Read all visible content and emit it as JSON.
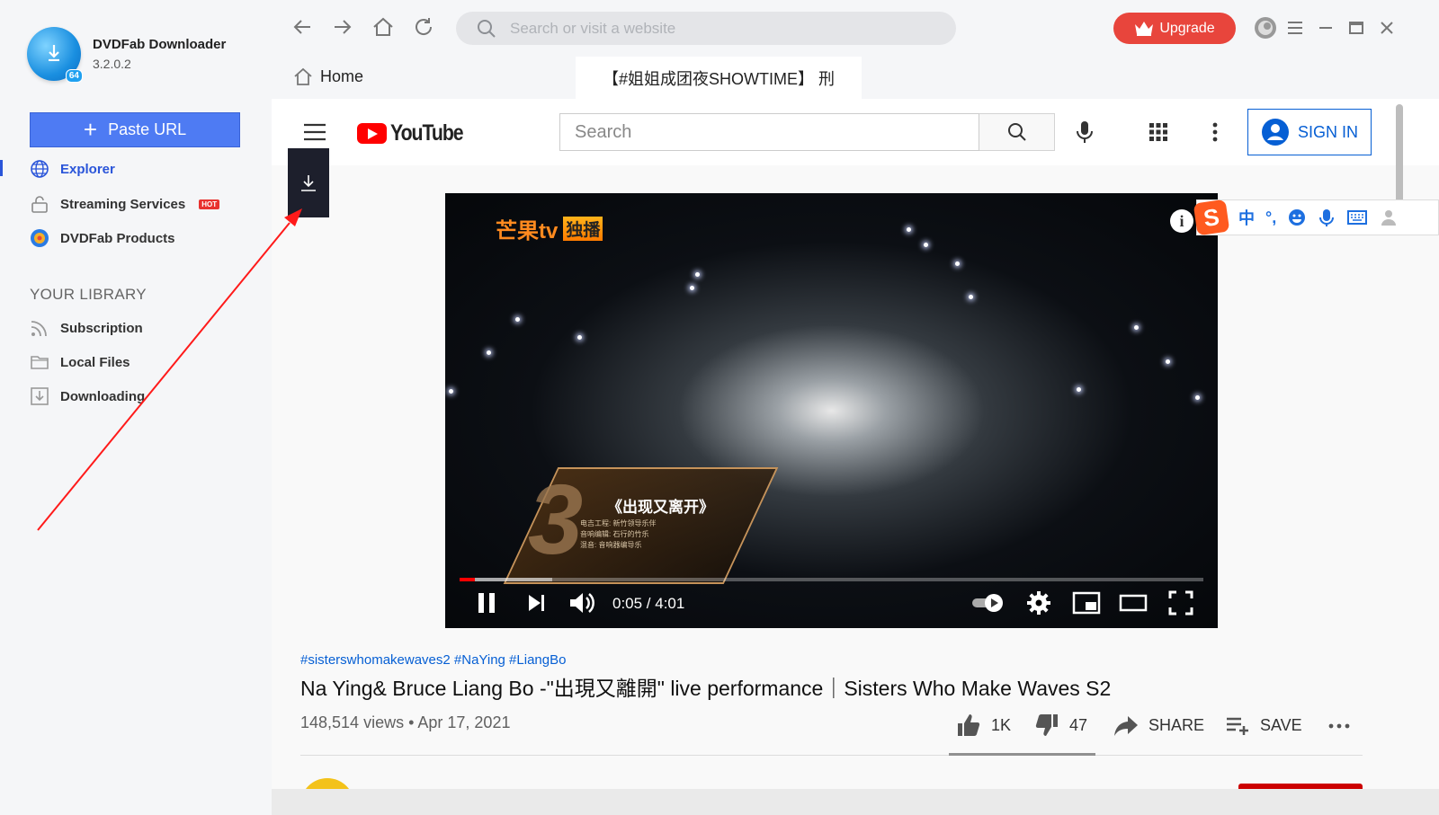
{
  "app": {
    "name": "DVDFab Downloader",
    "version": "3.2.0.2",
    "logo_badge": "64",
    "paste_url_label": "Paste URL",
    "nav": [
      {
        "label": "Explorer",
        "icon": "globe-icon",
        "active": true
      },
      {
        "label": "Streaming Services",
        "icon": "lock-icon",
        "badge": "HOT"
      },
      {
        "label": "DVDFab Products",
        "icon": "dvdfab-icon"
      }
    ],
    "library_title": "YOUR LIBRARY",
    "library": [
      {
        "label": "Subscription",
        "icon": "rss-icon"
      },
      {
        "label": "Local Files",
        "icon": "folder-icon"
      },
      {
        "label": "Downloading",
        "icon": "download-icon"
      }
    ],
    "accent_color": "#4e7bf3"
  },
  "topbar": {
    "address_placeholder": "Search or visit a website",
    "upgrade_label": "Upgrade"
  },
  "tabs": {
    "home_label": "Home",
    "active_tab_label": "【#姐姐成团夜SHOWTIME】 刑"
  },
  "youtube": {
    "logo_text": "YouTube",
    "search_placeholder": "Search",
    "sign_in_label": "SIGN IN",
    "player": {
      "channel_logo": "芒果tv",
      "channel_exclusive": "独播",
      "song_title": "《出现又离开》",
      "credits": [
        "电吉工程: 新竹领导乐伴",
        "音响编辑: 石行的竹乐",
        "混音: 音响器编导乐"
      ],
      "time": "0:05 / 4:01",
      "progress": 0.021,
      "buffered": 0.125
    },
    "hashtags": "#sisterswhomakewaves2 #NaYing #LiangBo",
    "title": "Na Ying& Bruce Liang Bo -\"出現又離開\" live performance｜Sisters Who Make Waves S2",
    "views": "148,514 views",
    "date": "Apr 17, 2021",
    "likes": "1K",
    "dislikes": "47",
    "share_label": "SHARE",
    "save_label": "SAVE"
  },
  "ime": {
    "logo": "S",
    "mode": "中",
    "punct": "°,"
  }
}
